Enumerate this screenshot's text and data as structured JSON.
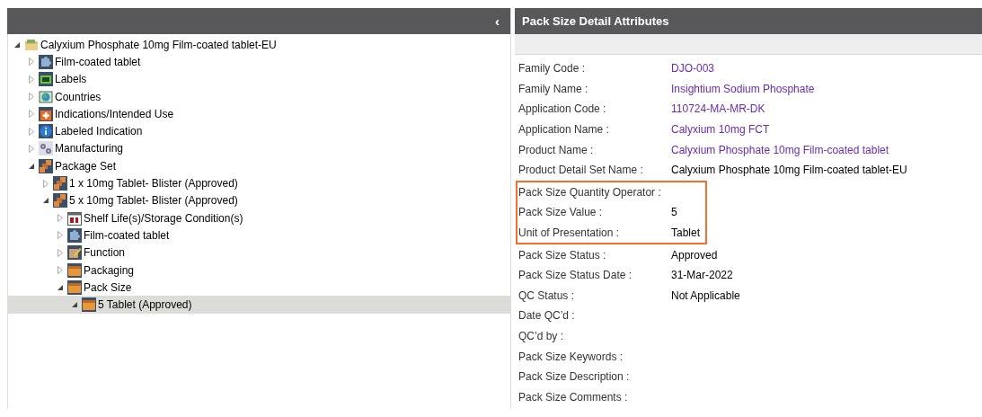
{
  "left_panel": {
    "collapse_button": "‹",
    "tree": [
      {
        "label": "Calyxium Phosphate 10mg Film-coated tablet-EU",
        "kind": "folder",
        "expanded": true,
        "selected": false,
        "children": [
          {
            "label": "Film-coated tablet",
            "kind": "puzzle",
            "expanded": false,
            "selected": false
          },
          {
            "label": "Labels",
            "kind": "labels",
            "expanded": false,
            "selected": false
          },
          {
            "label": "Countries",
            "kind": "globe",
            "expanded": false,
            "selected": false
          },
          {
            "label": "Indications/Intended Use",
            "kind": "medical",
            "expanded": false,
            "selected": false
          },
          {
            "label": "Labeled Indication",
            "kind": "info",
            "expanded": false,
            "selected": false
          },
          {
            "label": "Manufacturing",
            "kind": "gears",
            "expanded": false,
            "selected": false
          },
          {
            "label": "Package Set",
            "kind": "boxes",
            "expanded": true,
            "selected": false,
            "children": [
              {
                "label": "1 x 10mg Tablet- Blister (Approved)",
                "kind": "boxes",
                "expanded": false,
                "selected": false
              },
              {
                "label": "5 x 10mg Tablet- Blister (Approved)",
                "kind": "boxes",
                "expanded": true,
                "selected": false,
                "children": [
                  {
                    "label": "Shelf Life(s)/Storage Condition(s)",
                    "kind": "calendar",
                    "expanded": false,
                    "selected": false
                  },
                  {
                    "label": "Film-coated tablet",
                    "kind": "puzzle",
                    "expanded": false,
                    "selected": false
                  },
                  {
                    "label": "Function",
                    "kind": "edit",
                    "expanded": false,
                    "selected": false
                  },
                  {
                    "label": "Packaging",
                    "kind": "box",
                    "expanded": false,
                    "selected": false
                  },
                  {
                    "label": "Pack Size",
                    "kind": "box",
                    "expanded": true,
                    "selected": false,
                    "children": [
                      {
                        "label": "5 Tablet (Approved)",
                        "kind": "box",
                        "expanded": true,
                        "selected": true
                      }
                    ]
                  }
                ]
              }
            ]
          }
        ]
      }
    ]
  },
  "right_panel": {
    "title": "Pack Size Detail Attributes",
    "attributes": [
      {
        "label": "Family Code :",
        "value": "DJO-003",
        "kind": "link",
        "highlighted": false
      },
      {
        "label": "Family Name :",
        "value": "Insightium Sodium Phosphate",
        "kind": "link",
        "highlighted": false
      },
      {
        "label": "Application Code :",
        "value": "110724-MA-MR-DK",
        "kind": "link",
        "highlighted": false
      },
      {
        "label": "Application Name :",
        "value": "Calyxium 10mg FCT",
        "kind": "link",
        "highlighted": false
      },
      {
        "label": "Product Name :",
        "value": "Calyxium Phosphate 10mg Film-coated tablet",
        "kind": "link",
        "highlighted": false
      },
      {
        "label": "Product Detail Set Name :",
        "value": "Calyxium Phosphate 10mg Film-coated tablet-EU",
        "kind": "text",
        "highlighted": false
      },
      {
        "label": "Pack Size Quantity Operator :",
        "kind": "text",
        "highlighted": true
      },
      {
        "label": "Pack Size Value :",
        "value": "5",
        "kind": "text",
        "highlighted": true
      },
      {
        "label": "Unit of Presentation :",
        "value": "Tablet",
        "kind": "text",
        "highlighted": true
      },
      {
        "label": "Pack Size Status :",
        "value": "Approved",
        "kind": "text",
        "highlighted": false
      },
      {
        "label": "Pack Size Status Date :",
        "value": "31-Mar-2022",
        "kind": "text",
        "highlighted": false
      },
      {
        "label": "QC Status :",
        "value": "Not Applicable",
        "kind": "text",
        "highlighted": false
      },
      {
        "label": "Date QC’d :",
        "kind": "text",
        "highlighted": false
      },
      {
        "label": "QC’d by :",
        "kind": "text",
        "highlighted": false
      },
      {
        "label": "Pack Size Keywords :",
        "kind": "text",
        "highlighted": false
      },
      {
        "label": "Pack Size Description :",
        "kind": "text",
        "highlighted": false
      },
      {
        "label": "Pack Size Comments :",
        "kind": "text",
        "highlighted": false
      }
    ]
  }
}
